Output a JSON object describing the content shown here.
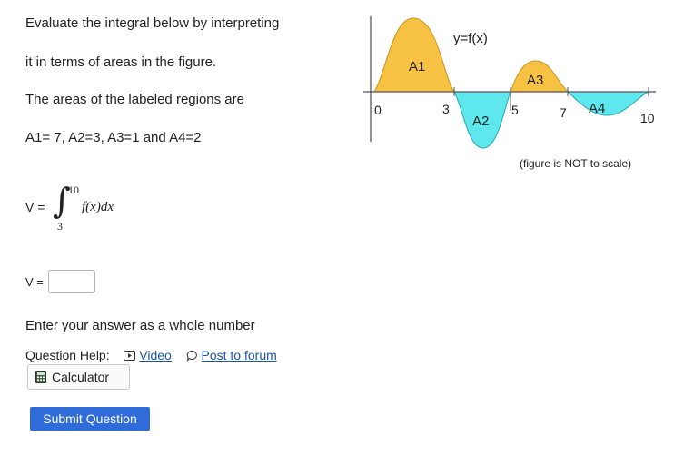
{
  "question": {
    "line1": "Evaluate the integral below by interpreting",
    "line2": "it in terms of areas in the figure.",
    "line3": "The areas of the labeled regions are",
    "line4": "A1= 7, A2=3, A3=1 and A4=2"
  },
  "integral": {
    "prefix": "V =",
    "upper": "10",
    "lower": "3",
    "integrand": "f(x)dx"
  },
  "answer": {
    "label": "V =",
    "value": "",
    "instruction": "Enter your answer as a whole number"
  },
  "help": {
    "label": "Question Help:",
    "video": "Video",
    "forum": "Post to forum",
    "calculator": "Calculator"
  },
  "submit_label": "Submit Question",
  "figure": {
    "function_label": "y=f(x)",
    "note": "(figure is NOT to scale)",
    "x_ticks": [
      "0",
      "3",
      "5",
      "7",
      "10"
    ],
    "regions": [
      "A1",
      "A2",
      "A3",
      "A4"
    ],
    "colors": {
      "above": "#f7c244",
      "below": "#5ee8ee"
    }
  }
}
